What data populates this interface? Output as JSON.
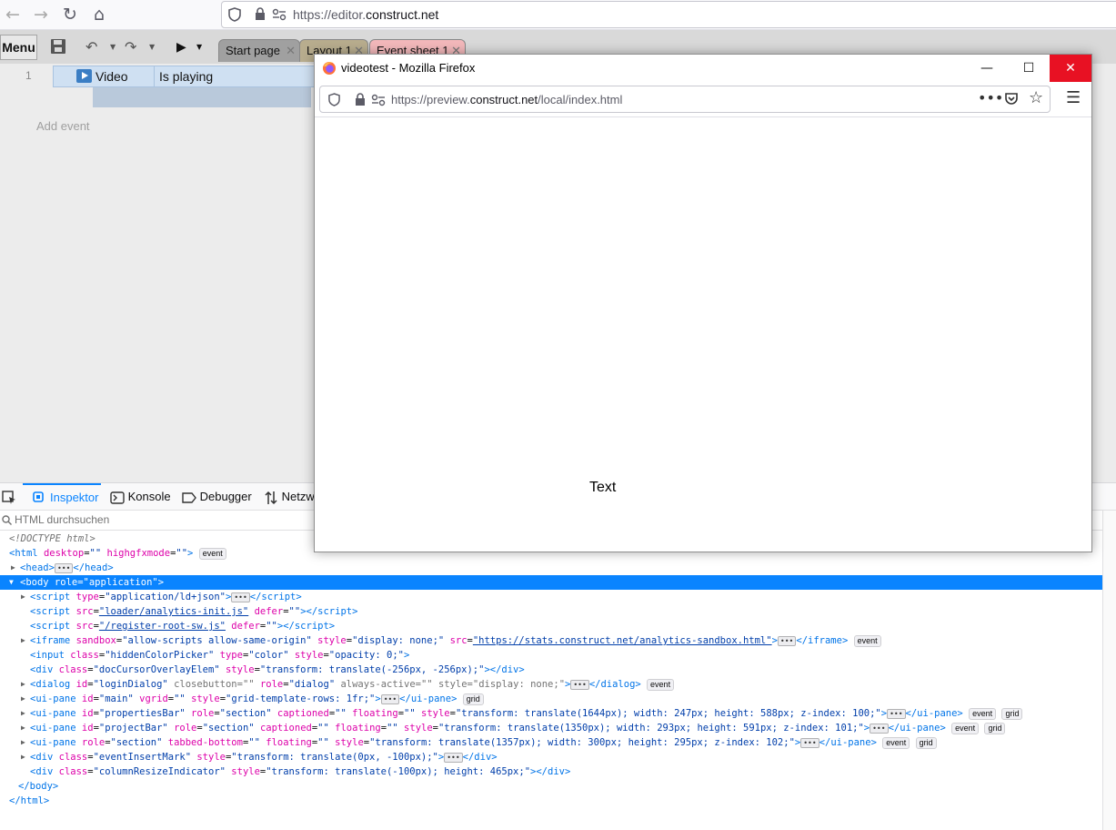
{
  "browser": {
    "url_prefix": "https://editor.",
    "url_domain": "construct.net"
  },
  "editor": {
    "menu_label": "Menu",
    "tabs": [
      {
        "label": "Start page"
      },
      {
        "label": "Layout 1"
      },
      {
        "label": "Event sheet 1"
      }
    ],
    "event": {
      "number": "1",
      "object": "Video",
      "condition": "Is playing"
    },
    "add_event": "Add event"
  },
  "devtools": {
    "tabs": [
      "Inspektor",
      "Konsole",
      "Debugger",
      "Netzw"
    ],
    "search_placeholder": "HTML durchsuchen"
  },
  "popup": {
    "title": "videotest - Mozilla Firefox",
    "url_prefix": "https://preview.",
    "url_domain": "construct.net",
    "url_path": "/local/index.html",
    "canvas_text": "Text"
  },
  "colors": {
    "selection": "#0a84ff",
    "close_button": "#e81123",
    "event_row": "#cfe0f2"
  }
}
